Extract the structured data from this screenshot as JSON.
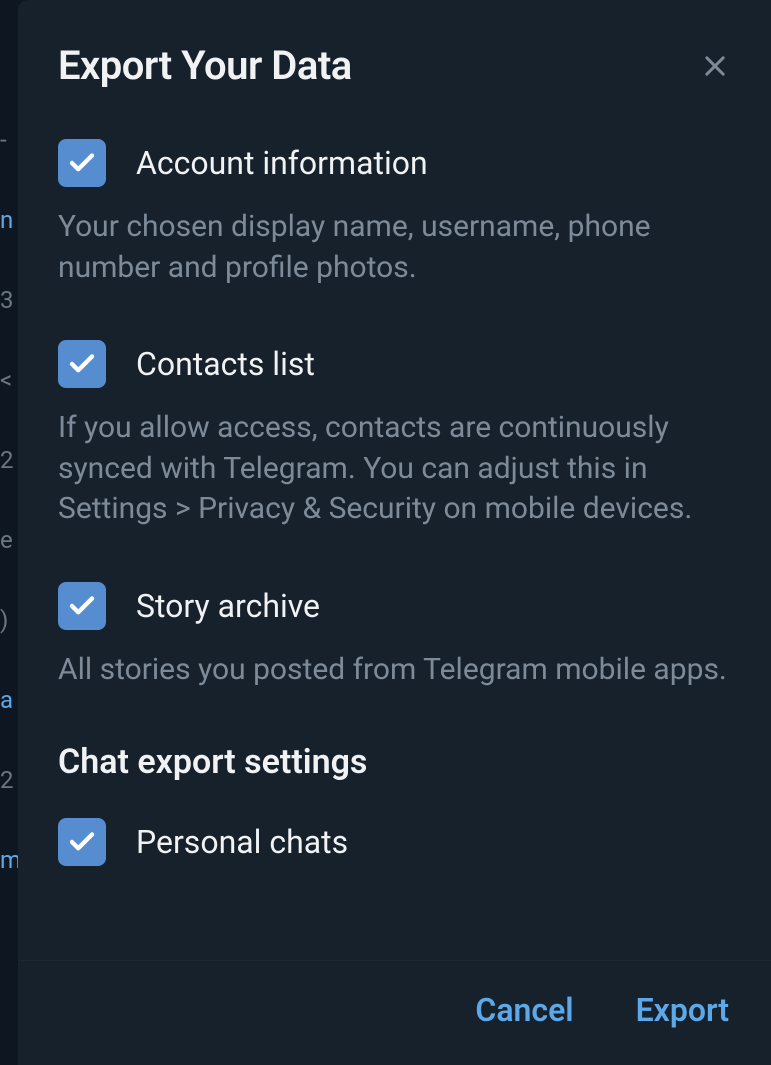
{
  "modal": {
    "title": "Export Your Data",
    "options": [
      {
        "label": "Account information",
        "description": "Your chosen display name, username, phone number and profile photos.",
        "checked": true
      },
      {
        "label": "Contacts list",
        "description": "If you allow access, contacts are continuously synced with Telegram. You can adjust this in Settings > Privacy & Security on mobile devices.",
        "checked": true
      },
      {
        "label": "Story archive",
        "description": "All stories you posted from Telegram mobile apps.",
        "checked": true
      }
    ],
    "section_heading": "Chat export settings",
    "chat_options": [
      {
        "label": "Personal chats",
        "checked": true
      }
    ],
    "footer": {
      "cancel": "Cancel",
      "export": "Export"
    }
  }
}
